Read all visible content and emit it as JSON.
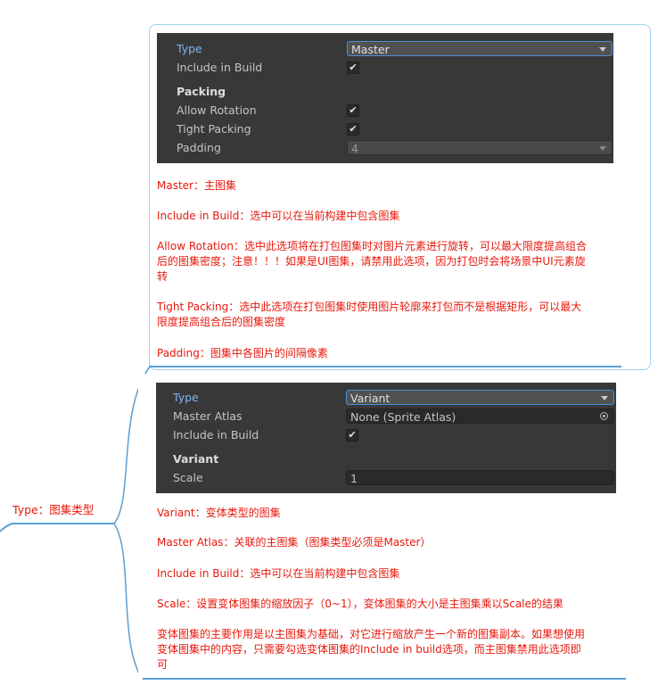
{
  "root": {
    "label": "Type：图集类型"
  },
  "master_card": {
    "inspector": {
      "type_label": "Type",
      "type_value": "Master",
      "include_label": "Include in Build",
      "include_checked": "✔",
      "packing_header": "Packing",
      "allow_rotation_label": "Allow Rotation",
      "allow_rotation_checked": "✔",
      "tight_packing_label": "Tight Packing",
      "tight_packing_checked": "✔",
      "padding_label": "Padding",
      "padding_value": "4"
    },
    "notes": {
      "master": "Master：主图集",
      "include": "Include in Build：选中可以在当前构建中包含图集",
      "allow_rotation_1": "Allow Rotation：选中此选项将在打包图集时对图片元素进行旋转，可以最大限度提高组合",
      "allow_rotation_2": "后的图集密度；注意！！！如果是UI图集，请禁用此选项，因为打包时会将场景中UI元素旋",
      "allow_rotation_3": "转",
      "tight_packing_1": "Tight Packing：选中此选项在打包图集时使用图片轮廓来打包而不是根据矩形，可以最大",
      "tight_packing_2": "限度提高组合后的图集密度",
      "padding": "Padding：图集中各图片的间隔像素"
    }
  },
  "variant_card": {
    "inspector": {
      "type_label": "Type",
      "type_value": "Variant",
      "master_atlas_label": "Master Atlas",
      "master_atlas_value": "None (Sprite Atlas)",
      "include_label": "Include in Build",
      "include_checked": "✔",
      "variant_header": "Variant",
      "scale_label": "Scale",
      "scale_value": "1"
    },
    "notes": {
      "variant": "Variant：变体类型的图集",
      "master_atlas": "Master Atlas：关联的主图集（图集类型必须是Master）",
      "include": "Include in Build：选中可以在当前构建中包含图集",
      "scale": "Scale：设置变体图集的缩放因子（0~1），变体图集的大小是主图集乘以Scale的结果",
      "purpose_1": "变体图集的主要作用是以主图集为基础，对它进行缩放产生一个新的图集副本。如果想使用",
      "purpose_2": "变体图集中的内容，只需要勾选变体图集的Include in build选项，而主图集禁用此选项即",
      "purpose_3": "可"
    }
  },
  "colors": {
    "note_text": "#e8180c",
    "connector": "#5a9fd4",
    "inspector_bg": "#383838",
    "type_label": "#7bb5f0"
  }
}
